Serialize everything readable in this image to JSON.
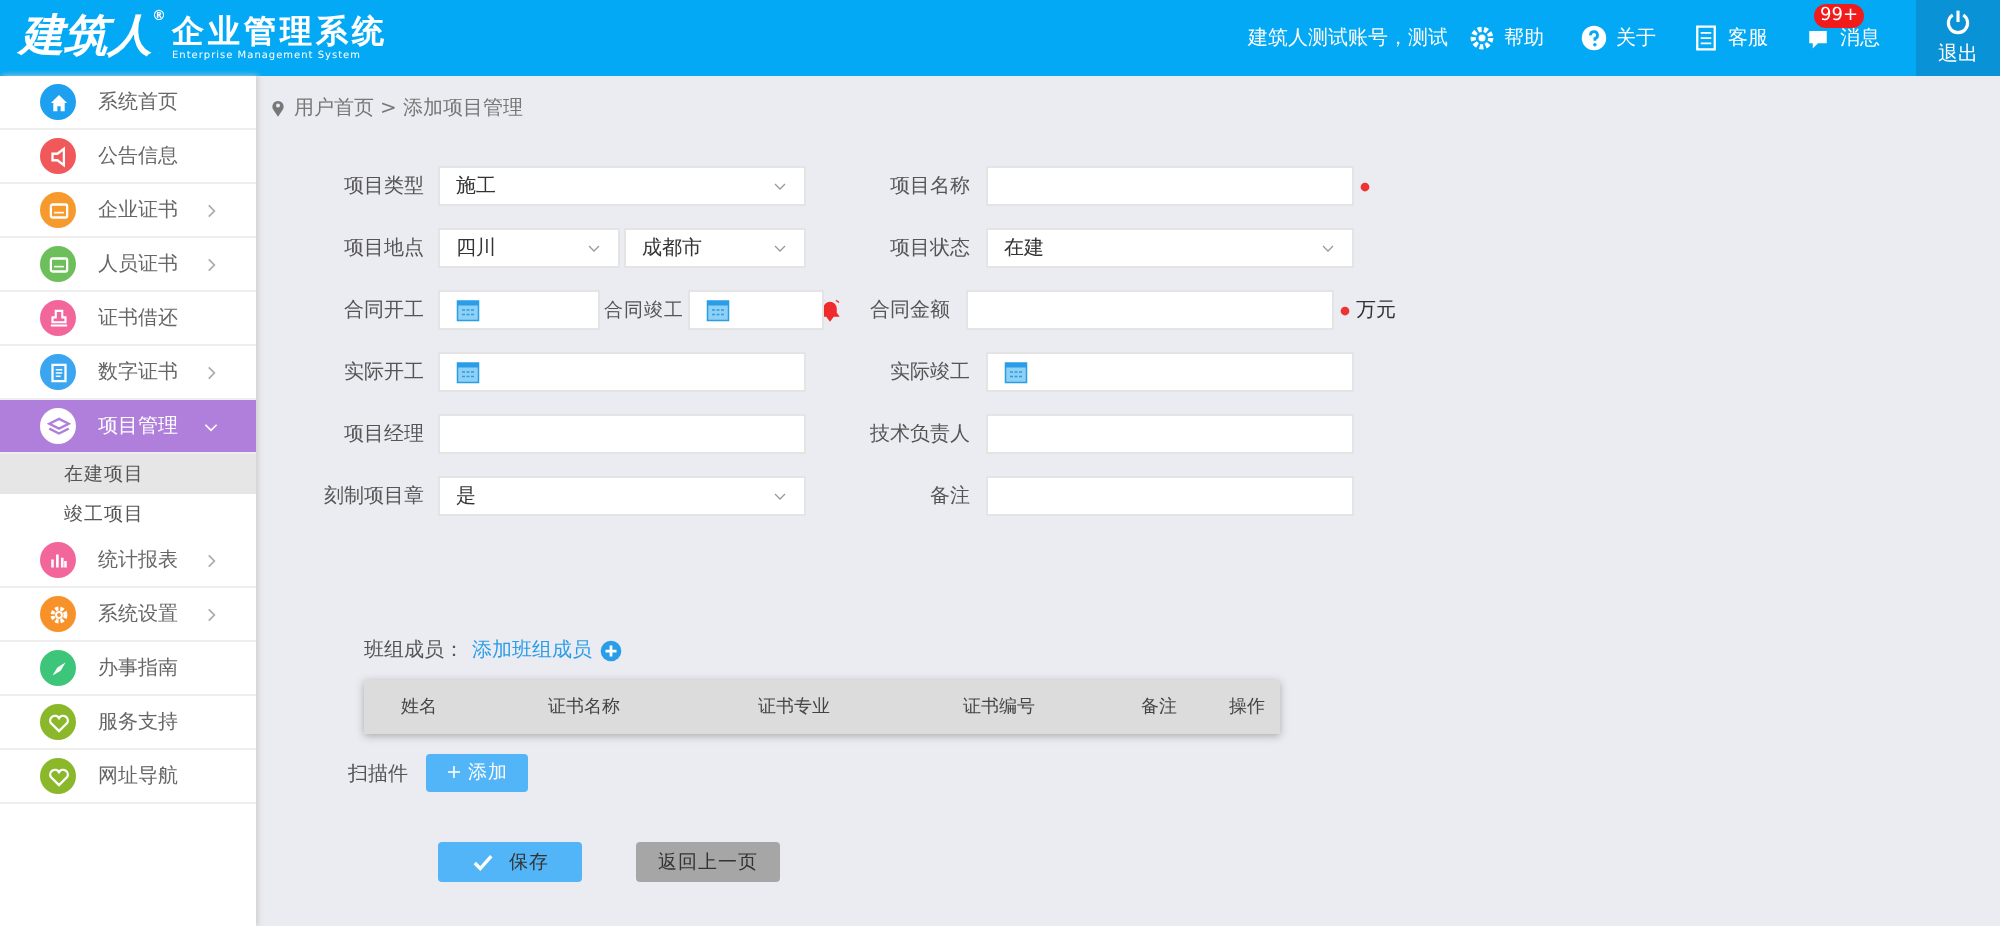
{
  "header": {
    "logo": "建筑人",
    "logo_mark": "®",
    "title": "企业管理系统",
    "subtitle": "Enterprise Management System",
    "user": "建筑人测试账号，测试",
    "links": [
      {
        "kind": "gear",
        "label": "帮助"
      },
      {
        "kind": "question",
        "label": "关于"
      },
      {
        "kind": "doc",
        "label": "客服"
      },
      {
        "kind": "bubble",
        "label": "消息",
        "badge": "99+"
      }
    ],
    "logout": "退出"
  },
  "sidebar": {
    "items": [
      {
        "label": "系统首页",
        "color": "#1ea0f0",
        "selected": false,
        "has_children": false
      },
      {
        "label": "公告信息",
        "color": "#f0585a",
        "selected": false,
        "has_children": false
      },
      {
        "label": "企业证书",
        "color": "#f79a2e",
        "selected": false,
        "has_children": true,
        "expanded": false
      },
      {
        "label": "人员证书",
        "color": "#6cbf5a",
        "selected": false,
        "has_children": true,
        "expanded": false
      },
      {
        "label": "证书借还",
        "color": "#f2669c",
        "selected": false,
        "has_children": false
      },
      {
        "label": "数字证书",
        "color": "#3aa5f0",
        "selected": false,
        "has_children": true,
        "expanded": false
      },
      {
        "label": "项目管理",
        "color": "#ffffff",
        "selected": true,
        "has_children": true,
        "expanded": true,
        "children": [
          {
            "label": "在建项目",
            "selected": true
          },
          {
            "label": "竣工项目",
            "selected": false
          }
        ]
      },
      {
        "label": "统计报表",
        "color": "#f2669c",
        "selected": false,
        "has_children": true,
        "expanded": false
      },
      {
        "label": "系统设置",
        "color": "#f7922a",
        "selected": false,
        "has_children": true,
        "expanded": false
      },
      {
        "label": "办事指南",
        "color": "#3dc67a",
        "selected": false,
        "has_children": false
      },
      {
        "label": "服务支持",
        "color": "#8ab82a",
        "selected": false,
        "has_children": false
      },
      {
        "label": "网址导航",
        "color": "#8ab82a",
        "selected": false,
        "has_children": false
      }
    ]
  },
  "breadcrumb": {
    "home": "用户首页",
    "separator": ">",
    "current": "添加项目管理"
  },
  "form": {
    "rows": [
      {
        "left": {
          "label": "项目类型",
          "kind": "select",
          "value": "施工"
        },
        "right": {
          "label": "项目名称",
          "kind": "text",
          "required": true
        }
      },
      {
        "left": {
          "label": "项目地点",
          "kind": "select_pair",
          "values": [
            "四川",
            "成都市"
          ]
        },
        "right": {
          "label": "项目状态",
          "kind": "select",
          "value": "在建"
        }
      },
      {
        "left": {
          "label": "合同开工",
          "kind": "date_range",
          "second_label": "合同竣工",
          "alert": true
        },
        "right": {
          "label": "合同金额",
          "kind": "text",
          "required": true,
          "suffix": "万元"
        }
      },
      {
        "left": {
          "label": "实际开工",
          "kind": "date"
        },
        "right": {
          "label": "实际竣工",
          "kind": "date"
        }
      },
      {
        "left": {
          "label": "项目经理",
          "kind": "text"
        },
        "right": {
          "label": "技术负责人",
          "kind": "text"
        }
      },
      {
        "left": {
          "label": "刻制项目章",
          "kind": "select",
          "value": "是"
        },
        "right": {
          "label": "备注",
          "kind": "text"
        }
      }
    ]
  },
  "team": {
    "label": "班组成员：",
    "add_link": "添加班组成员",
    "columns": [
      "姓名",
      "证书名称",
      "证书专业",
      "证书编号",
      "备注",
      "操作"
    ]
  },
  "scan": {
    "label": "扫描件",
    "button": "+ 添加"
  },
  "buttons": [
    {
      "kind": "primary",
      "label": "保存"
    },
    {
      "kind": "secondary",
      "label": "返回上一页"
    }
  ]
}
